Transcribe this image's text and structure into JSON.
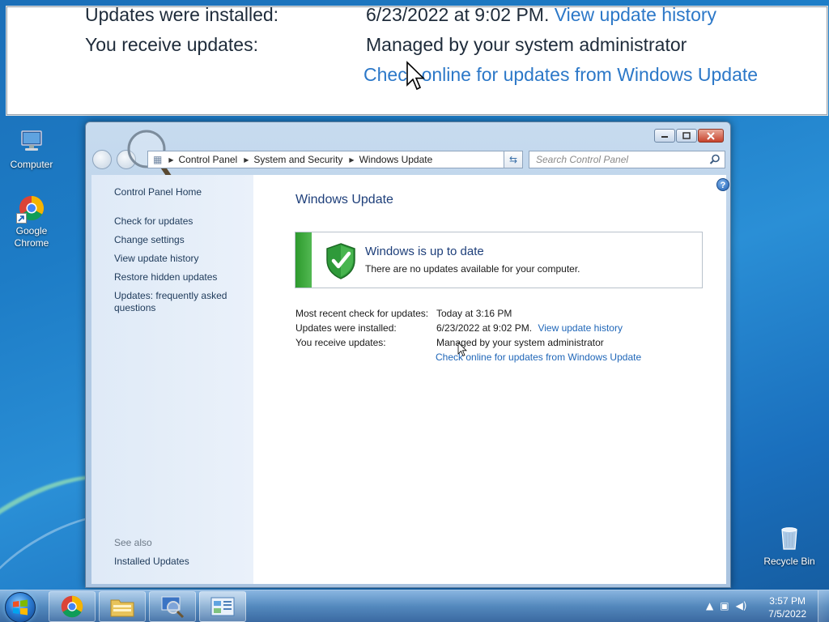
{
  "zoom": {
    "installed_label": "Updates were installed:",
    "installed_value": "6/23/2022 at 9:02 PM.",
    "history_link": "View update history",
    "receive_label": "You receive updates:",
    "receive_value": "Managed by your system administrator",
    "check_online_link": "Check online for updates from Windows Update"
  },
  "desktop": {
    "icons": [
      {
        "label": "Computer",
        "icon": "computer-icon"
      },
      {
        "label": "Google Chrome",
        "icon": "chrome-icon"
      },
      {
        "label": "Recycle Bin",
        "icon": "recycle-bin-icon"
      }
    ]
  },
  "window": {
    "breadcrumb": [
      "Control Panel",
      "System and Security",
      "Windows Update"
    ],
    "search_placeholder": "Search Control Panel",
    "left_pane": {
      "home": "Control Panel Home",
      "links": [
        "Check for updates",
        "Change settings",
        "View update history",
        "Restore hidden updates",
        "Updates: frequently asked questions"
      ],
      "see_also_label": "See also",
      "see_also_links": [
        "Installed Updates"
      ]
    },
    "content": {
      "title": "Windows Update",
      "status_title": "Windows is up to date",
      "status_sub": "There are no updates available for your computer.",
      "info": [
        {
          "label": "Most recent check for updates:",
          "value": "Today at 3:16 PM"
        },
        {
          "label": "Updates were installed:",
          "value": "6/23/2022 at 9:02 PM.",
          "link": "View update history"
        },
        {
          "label": "You receive updates:",
          "value": "Managed by your system administrator"
        }
      ],
      "check_online_link": "Check online for updates from Windows Update"
    }
  },
  "taskbar": {
    "pinned": [
      "chrome-icon",
      "explorer-icon",
      "magnifier-icon",
      "control-panel-icon"
    ],
    "clock_time": "3:57 PM",
    "clock_date": "7/5/2022"
  },
  "colors": {
    "accent_link": "#1f66b8",
    "status_green": "#2d9a2d",
    "title_blue": "#1e3f7a"
  }
}
